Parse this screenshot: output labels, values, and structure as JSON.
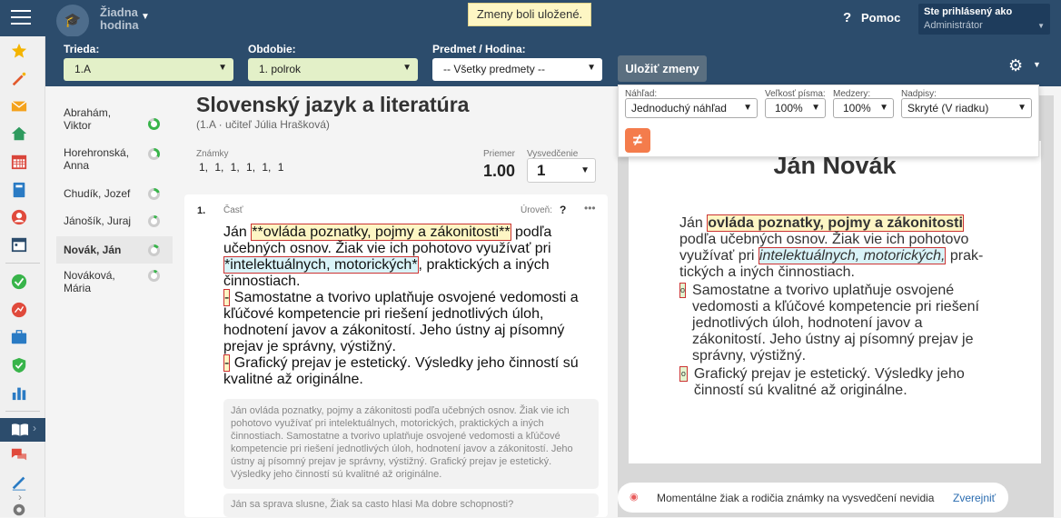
{
  "topbar": {
    "selected_lesson": "Žiadna hodina",
    "toast": "Zmeny boli uložené.",
    "help": "Pomoc",
    "user_line1": "Ste prihlásený ako",
    "user_line2": "Administrátor"
  },
  "filters": {
    "class_label": "Trieda:",
    "class_value": "1.A",
    "period_label": "Obdobie:",
    "period_value": "1. polrok",
    "subject_label": "Predmet / Hodina:",
    "subject_value": "-- Všetky predmety --",
    "save_button": "Uložiť zmeny"
  },
  "students": [
    {
      "name": "Abrahám, Viktor",
      "progress": 0.85
    },
    {
      "name": "Horehronská, Anna",
      "progress": 0.35
    },
    {
      "name": "Chudík, Jozef",
      "progress": 0.2
    },
    {
      "name": "Jánošík, Juraj",
      "progress": 0.1
    },
    {
      "name": "Novák, Ján",
      "progress": 0.15,
      "selected": true
    },
    {
      "name": "Nováková, Mária",
      "progress": 0.1
    }
  ],
  "main": {
    "subject": "Slovenský jazyk a literatúra",
    "subtitle": "(1.A · učiteľ Júlia Hrašková)",
    "grades_label": "Známky",
    "grades": "1, 1, 1, 1, 1, 1",
    "avg_label": "Priemer",
    "avg_value": "1.00",
    "cert_label": "Vysvedčenie",
    "cert_value": "1"
  },
  "card": {
    "number": "1.",
    "part_label": "Časť",
    "level_label": "Úroveň:",
    "level_value": "?",
    "editor": {
      "t1": "Ján ",
      "h1": "**ovláda poznatky, pojmy a zákonitosti**",
      "t2": " podľa učebných osnov. Žiak vie ich pohotovo využívať pri ",
      "h2": "*intelektuálnych, motorických*",
      "t3": ", praktických a iných činnostiach.",
      "d1": "-",
      "t4": " Samostatne a tvorivo uplatňuje osvojené vedomosti a kľúčové kompetencie pri riešení jednotlivých úloh, hodnotení javov a zákonitostí. Jeho ústny aj písomný prejav je správny, výstižný.",
      "d2": "-",
      "t5": " Grafický prejav je  estetický. Výsledky jeho činností sú kvalitné až originálne."
    },
    "preview": "Ján ovláda poznatky, pojmy a zákonitosti podľa učebných osnov. Žiak vie ich pohotovo využívať pri intelektuálnych, motorických, praktických a iných činnostiach. Samostatne a tvorivo uplatňuje osvojené vedomosti a kľúčové kompetencie pri riešení jednotlivých úloh, hodnotení javov a zákonitostí. Jeho ústny aj písomný prejav je správny, výstižný. Grafický prejav je estetický. Výsledky jeho činností sú kvalitné až originálne.",
    "preview2": "Ján sa sprava slusne, Žiak sa casto hlasi Ma dobre schopnosti?"
  },
  "view_panel": {
    "view_label": "Náhľad:",
    "view_value": "Jednoduchý náhľad",
    "font_label": "Veľkosť písma:",
    "font_value": "100%",
    "spacing_label": "Medzery:",
    "spacing_value": "100%",
    "headings_label": "Nadpisy:",
    "headings_value": "Skryté (V riadku)"
  },
  "paper": {
    "name": "Ján Novák",
    "p1a": "Ján ",
    "p1b": "ovláda poznatky, pojmy a zákonitosti",
    "p1c": " podľa učebných osnov. Žiak vie ich pohotovo využívať pri ",
    "p1d": "intelektuálnych, motorických,",
    "p1e": " prak-tických a iných činnostiach.",
    "bullet": "o",
    "item1": "Samostatne a tvorivo uplatňuje osvojené vedomosti a kľúčové kompetencie pri riešení jednotlivých úloh, hodnotení javov a zákonitostí. Jeho ústny aj písomný prejav je správny, výstižný.",
    "item2": "Grafický prejav je estetický. Výsledky jeho činností sú kvalitné až originálne."
  },
  "notice": {
    "text": "Momentálne žiak a rodičia známky na vysvedčení nevidia",
    "link": "Zverejniť"
  },
  "colors": {
    "navy": "#2c4c6c",
    "select_green": "#e3f0c8",
    "orange": "#f47c4c"
  }
}
